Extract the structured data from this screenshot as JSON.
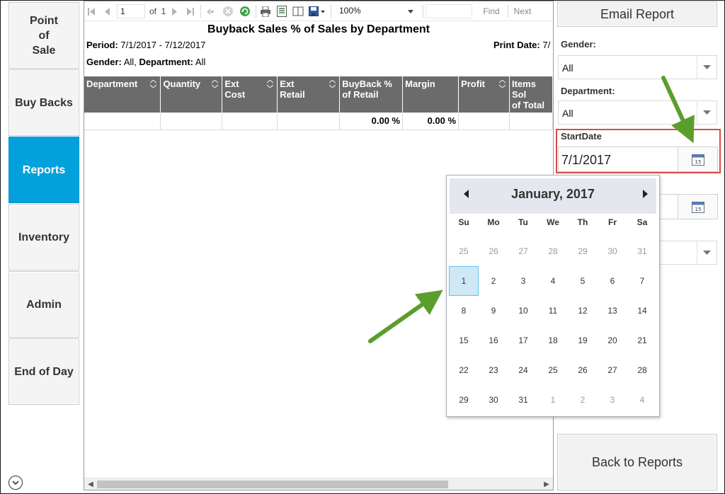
{
  "nav": {
    "items": [
      {
        "label": "Point\nof\nSale",
        "active": false
      },
      {
        "label": "Buy Backs",
        "active": false
      },
      {
        "label": "Reports",
        "active": true
      },
      {
        "label": "Inventory",
        "active": false
      },
      {
        "label": "Admin",
        "active": false
      },
      {
        "label": "End of Day",
        "active": false
      }
    ],
    "expand_icon": "chevron-down-circle-icon",
    "active_color": "#03a1dc"
  },
  "toolbar": {
    "page_current": "1",
    "page_of": "of",
    "page_total": "1",
    "zoom": "100%",
    "find_label": "Find",
    "next_label": "Next"
  },
  "report": {
    "title": "Buyback Sales % of Sales by Department",
    "period_label": "Period:",
    "period_value": "7/1/2017 - 7/12/2017",
    "print_date_label": "Print Date:",
    "print_date_value": "7/",
    "gender_label": "Gender:",
    "gender_value": "All,",
    "department_label": "Department:",
    "department_value": "All",
    "columns": [
      "Department",
      "Quantity",
      "Ext\nCost",
      "Ext\nRetail",
      "BuyBack %\nof Retail",
      "Margin",
      "Profit",
      "Items Sol\nof Total"
    ],
    "row": [
      "",
      "",
      "",
      "",
      "0.00 %",
      "0.00 %",
      "",
      ""
    ],
    "header_color": "#6b6b6b"
  },
  "panel": {
    "email_button": "Email Report",
    "gender_label": "Gender:",
    "gender_value": "All",
    "department_label": "Department:",
    "department_value": "All",
    "startdate_label": "StartDate",
    "startdate_value": "7/1/2017",
    "back_button": "Back to Reports",
    "highlight_color": "#d94a49"
  },
  "calendar": {
    "title": "January, 2017",
    "weekdays": [
      "Su",
      "Mo",
      "Tu",
      "We",
      "Th",
      "Fr",
      "Sa"
    ],
    "weeks": [
      [
        "25",
        "26",
        "27",
        "28",
        "29",
        "30",
        "31"
      ],
      [
        "1",
        "2",
        "3",
        "4",
        "5",
        "6",
        "7"
      ],
      [
        "8",
        "9",
        "10",
        "11",
        "12",
        "13",
        "14"
      ],
      [
        "15",
        "16",
        "17",
        "18",
        "19",
        "20",
        "21"
      ],
      [
        "22",
        "23",
        "24",
        "25",
        "26",
        "27",
        "28"
      ],
      [
        "29",
        "30",
        "31",
        "1",
        "2",
        "3",
        "4"
      ]
    ],
    "selected_day": "1",
    "selected_color": "#cfe8f5"
  },
  "annotation": {
    "arrow_color": "#5c9e2e"
  }
}
